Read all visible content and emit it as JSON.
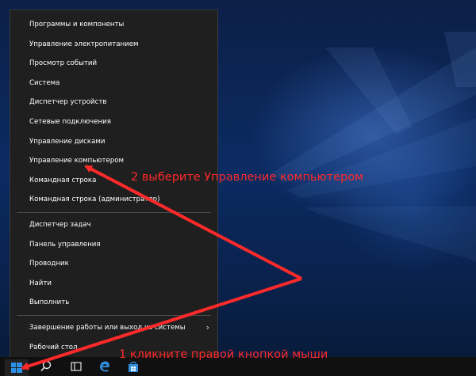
{
  "menu": {
    "group1": [
      {
        "id": "programs",
        "label": "Программы и компоненты"
      },
      {
        "id": "power",
        "label": "Управление электропитанием"
      },
      {
        "id": "event-viewer",
        "label": "Просмотр событий"
      },
      {
        "id": "system",
        "label": "Система"
      },
      {
        "id": "device-manager",
        "label": "Диспетчер устройств"
      },
      {
        "id": "network",
        "label": "Сетевые подключения"
      },
      {
        "id": "disk-management",
        "label": "Управление дисками"
      },
      {
        "id": "computer-management",
        "label": "Управление компьютером"
      },
      {
        "id": "cmd",
        "label": "Командная строка"
      },
      {
        "id": "cmd-admin",
        "label": "Командная строка (администратор)"
      }
    ],
    "group2": [
      {
        "id": "task-manager",
        "label": "Диспетчер задач"
      },
      {
        "id": "control-panel",
        "label": "Панель управления"
      },
      {
        "id": "explorer",
        "label": "Проводник"
      },
      {
        "id": "search",
        "label": "Найти"
      },
      {
        "id": "run",
        "label": "Выполнить"
      }
    ],
    "group3": [
      {
        "id": "shutdown",
        "label": "Завершение работы или выход из системы",
        "has_submenu": true
      },
      {
        "id": "desktop",
        "label": "Рабочий стол"
      }
    ]
  },
  "annotations": {
    "step2": "2 выберите Управление компьютером",
    "step1": "1 кликните правой кнопкой мыши"
  },
  "colors": {
    "annotation": "#ff2a2a",
    "menu_bg": "#1f1f1f",
    "taskbar_bg": "#101010",
    "start_icon": "#2b8fe8"
  },
  "icons": {
    "start": "windows-logo-icon",
    "search": "search-icon",
    "task_view": "task-view-icon",
    "edge": "edge-browser-icon",
    "store": "store-icon"
  }
}
